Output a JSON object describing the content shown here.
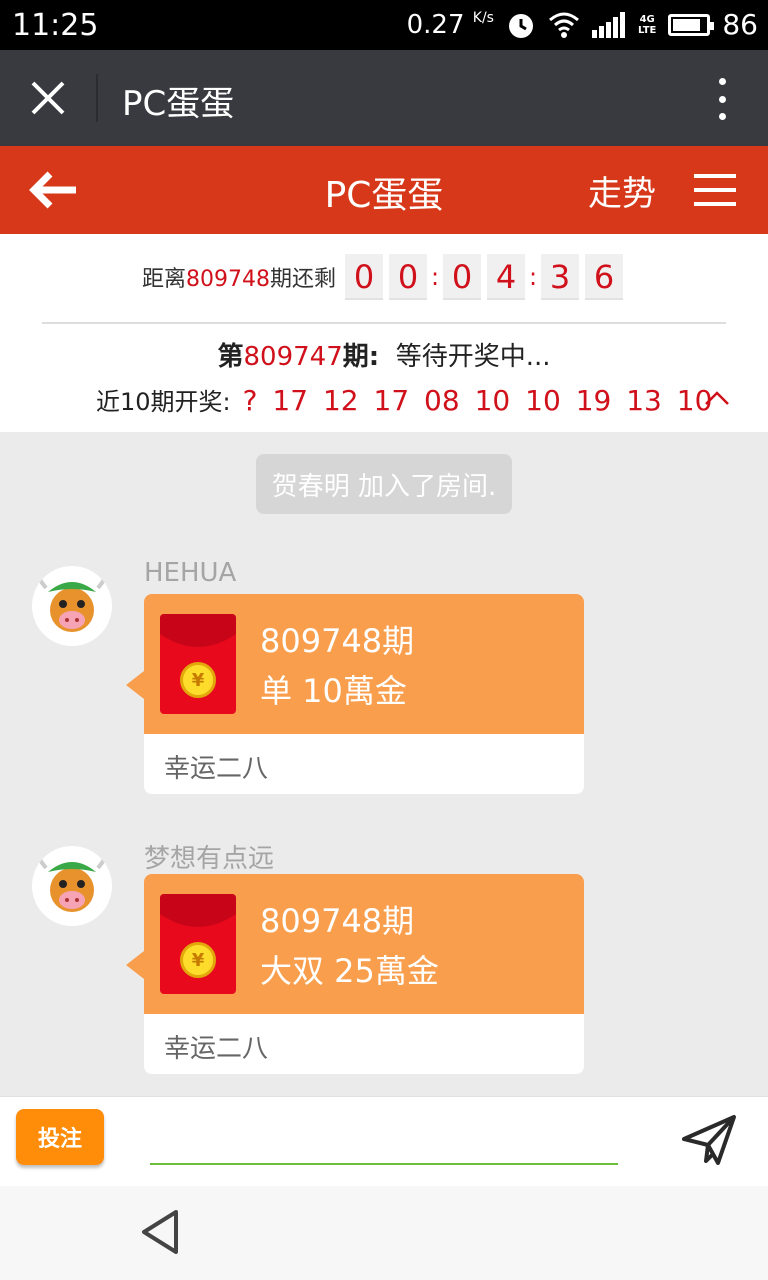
{
  "status_bar": {
    "time": "11:25",
    "speed": "0.27",
    "speed_unit": "K/s",
    "network": "4G",
    "network_sub": "LTE",
    "battery": "86",
    "battery_level": 0.86
  },
  "title_bar": {
    "title": "PC蛋蛋"
  },
  "header": {
    "title": "PC蛋蛋",
    "trend_label": "走势"
  },
  "countdown": {
    "prefix": "距离",
    "period": "809748",
    "suffix": "期还剩",
    "digits": [
      "0",
      "0",
      "0",
      "4",
      "3",
      "6"
    ]
  },
  "current_period": {
    "prefix": "第",
    "number": "809747",
    "suffix": "期:",
    "status": "等待开奖中..."
  },
  "history": {
    "label": "近10期开奖:",
    "results": [
      "?",
      "17",
      "12",
      "17",
      "08",
      "10",
      "10",
      "19",
      "13",
      "10"
    ]
  },
  "system_message": "贺春明 加入了房间.",
  "messages": [
    {
      "nickname": "HEHUA",
      "period": "809748期",
      "bet": "单 10萬金",
      "footer": "幸运二八"
    },
    {
      "nickname": "梦想有点远",
      "period": "809748期",
      "bet": "大双 25萬金",
      "footer": "幸运二八"
    }
  ],
  "input_bar": {
    "bet_button": "投注",
    "input_value": ""
  },
  "colors": {
    "header_red": "#d63819",
    "bubble_orange": "#f89e4c",
    "accent_red": "#d0111b",
    "bet_button": "#ff8d0a",
    "input_underline": "#6bbf3c"
  },
  "icons": {
    "close": "close-icon",
    "more": "more-vertical-icon",
    "back": "arrow-left-icon",
    "menu": "hamburger-icon",
    "collapse": "chevron-up-icon",
    "send": "paper-plane-icon",
    "nav_back": "triangle-back-icon"
  }
}
